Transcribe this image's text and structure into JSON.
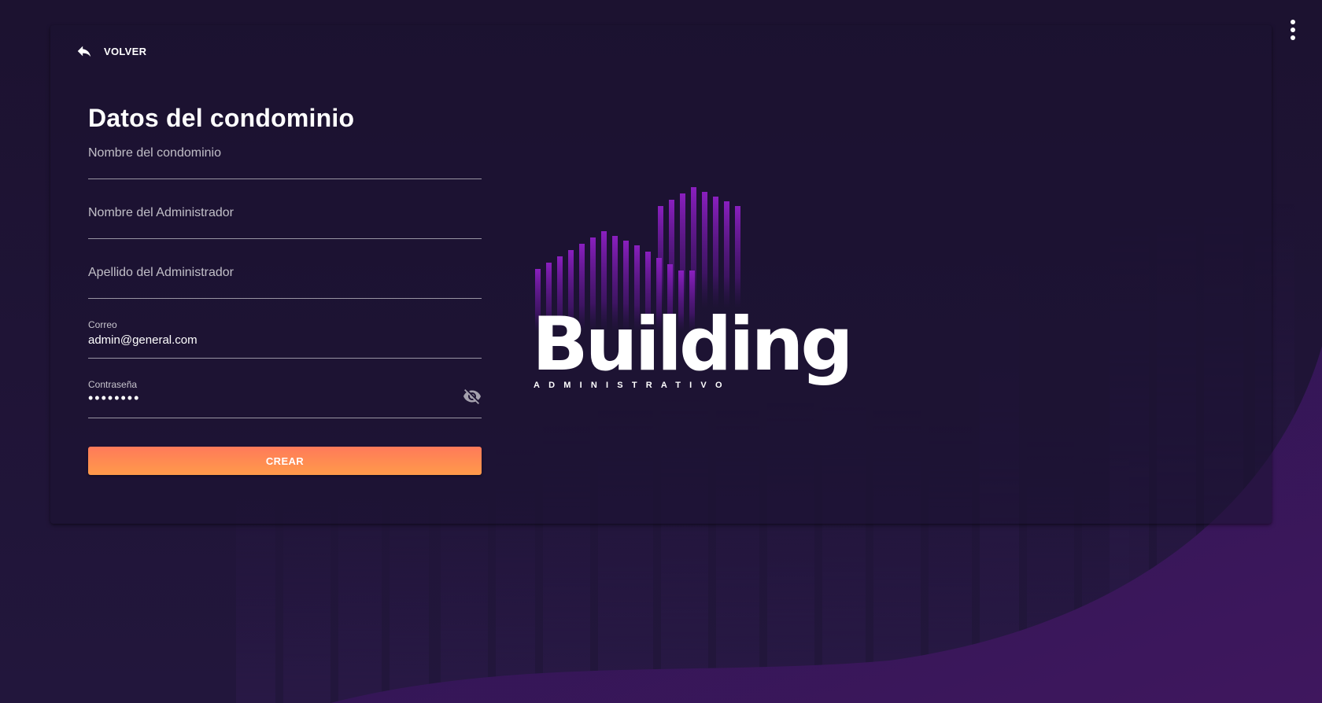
{
  "colors": {
    "background": "#1e1434",
    "accent_purple": "#7a1aa8",
    "button_gradient_start": "#ff7a5a",
    "button_gradient_end": "#ff9a4a"
  },
  "menu": {
    "icon": "more-vert-icon"
  },
  "back": {
    "label": "VOLVER",
    "icon": "reply-icon"
  },
  "form": {
    "title": "Datos del condominio",
    "fields": [
      {
        "placeholder": "Nombre del condominio",
        "value": ""
      },
      {
        "placeholder": "Nombre del Administrador",
        "value": ""
      },
      {
        "placeholder": "Apellido del Administrador",
        "value": ""
      },
      {
        "label": "Correo",
        "value": "admin@general.com"
      },
      {
        "label": "Contraseña",
        "value": "••••••••",
        "toggle_icon": "visibility-off-icon"
      }
    ],
    "submit_label": "CREAR"
  },
  "logo": {
    "word": "Building",
    "sub": "ADMINISTRATIVO"
  }
}
